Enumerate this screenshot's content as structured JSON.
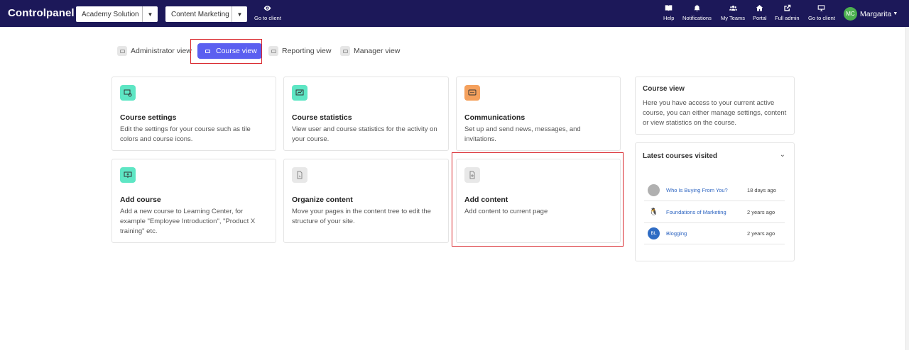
{
  "topbar": {
    "brand": "Controlpanel",
    "select1": "Academy Solution",
    "select2": "Content Marketing",
    "go_to_client_left": "Go to client",
    "nav": [
      {
        "label": "Help",
        "icon": "book-icon"
      },
      {
        "label": "Notifications",
        "icon": "bell-icon"
      },
      {
        "label": "My Teams",
        "icon": "team-icon"
      },
      {
        "label": "Portal",
        "icon": "home-icon"
      },
      {
        "label": "Full admin",
        "icon": "external-link-icon"
      },
      {
        "label": "Go to client",
        "icon": "monitor-icon"
      }
    ],
    "user": {
      "initials": "MC",
      "name": "Margarita"
    }
  },
  "views": [
    {
      "label": "Administrator view"
    },
    {
      "label": "Course view",
      "active": true
    },
    {
      "label": "Reporting view"
    },
    {
      "label": "Manager view"
    }
  ],
  "cards": [
    {
      "title": "Course settings",
      "desc": "Edit the settings for your course such as tile colors and course icons.",
      "icon_color": "#5ee6c4"
    },
    {
      "title": "Course statistics",
      "desc": "View user and course statistics for the activity on your course.",
      "icon_color": "#5ee6c4"
    },
    {
      "title": "Communications",
      "desc": "Set up and send news, messages, and invitations.",
      "icon_color": "#f5a15d"
    },
    {
      "title": "Add course",
      "desc": "Add a new course to Learning Center, for example \"Employee Introduction\", \"Product X training\" etc.",
      "icon_color": "#5ee6c4"
    },
    {
      "title": "Organize content",
      "desc": "Move your pages in the content tree to edit the structure of your site.",
      "icon_color": "#e8e8e8"
    },
    {
      "title": "Add content",
      "desc": "Add content to current page",
      "icon_color": "#e8e8e8"
    }
  ],
  "info_panel": {
    "title": "Course view",
    "text": "Here you have access to your current active course, you can either manage settings, content or view statistics on the course."
  },
  "latest": {
    "title": "Latest courses visited",
    "items": [
      {
        "name": "Who Is Buying From You?",
        "time": "18 days ago",
        "avatar": "",
        "avatar_color": "#b0b0b0"
      },
      {
        "name": "Foundations of Marketing",
        "time": "2 years ago",
        "avatar": "",
        "avatar_color": "#ffffff"
      },
      {
        "name": "Blogging",
        "time": "2 years ago",
        "avatar": "BL",
        "avatar_color": "#2f6cc4"
      }
    ]
  }
}
